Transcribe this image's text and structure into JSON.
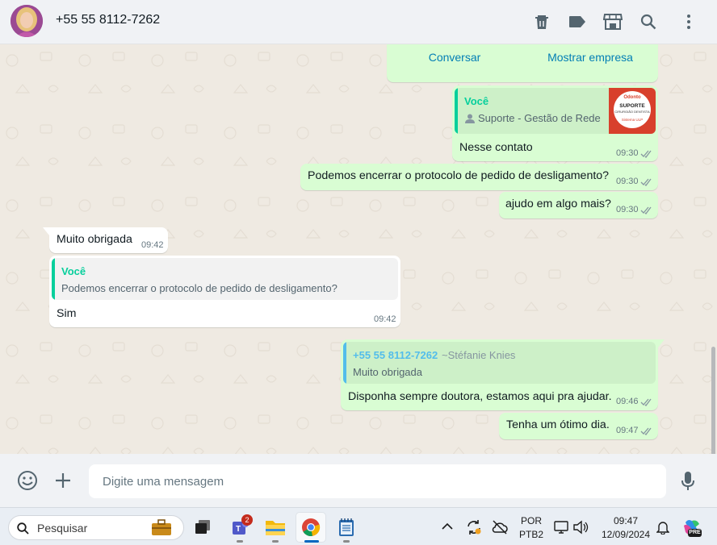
{
  "header": {
    "contact_name": "+55 55 8112-7262",
    "icons": [
      "delete-icon",
      "label-icon",
      "store-icon",
      "search-icon",
      "more-icon"
    ]
  },
  "business_card": {
    "chat_button": "Conversar",
    "show_business_button": "Mostrar empresa"
  },
  "messages": {
    "m1": {
      "quote_name": "Você",
      "quote_text": "Suporte - Gestão de Rede",
      "text": "Nesse contato",
      "time": "09:30",
      "thumb": {
        "brand": "Odonto",
        "line1": "SUPORTE",
        "line2": "CIRURGIÃO DENTISTA",
        "footer": "Sistema ULP"
      }
    },
    "m2": {
      "text": "Podemos encerrar o protocolo de pedido de desligamento?",
      "time": "09:30"
    },
    "m3": {
      "text": "ajudo em algo mais?",
      "time": "09:30"
    },
    "m4": {
      "text": "Muito obrigada",
      "time": "09:42"
    },
    "m5": {
      "quote_name": "Você",
      "quote_text": "Podemos encerrar o protocolo de pedido de desligamento?",
      "text": "Sim",
      "time": "09:42"
    },
    "m6": {
      "quote_name": "+55 55 8112-7262",
      "quote_pushname": "~Stéfanie Knies",
      "quote_text": "Muito obrigada",
      "text": "Disponha sempre doutora, estamos aqui pra ajudar.",
      "time": "09:46"
    },
    "m7": {
      "text": "Tenha um ótimo dia.",
      "time": "09:47"
    }
  },
  "composer": {
    "placeholder": "Digite uma mensagem"
  },
  "taskbar": {
    "search_label": "Pesquisar",
    "teams_badge": "2",
    "lang_top": "POR",
    "lang_bottom": "PTB2",
    "time": "09:47",
    "date": "12/09/2024",
    "copilot_badge": "PRE"
  },
  "colors": {
    "outgoing_bubble": "#d9fdd3",
    "incoming_bubble": "#ffffff",
    "chat_bg": "#efeae2",
    "accent_green": "#06cf9c",
    "link_blue": "#027eb5",
    "quote_blue": "#53bdeb",
    "read_ticks": "#8696a0"
  }
}
